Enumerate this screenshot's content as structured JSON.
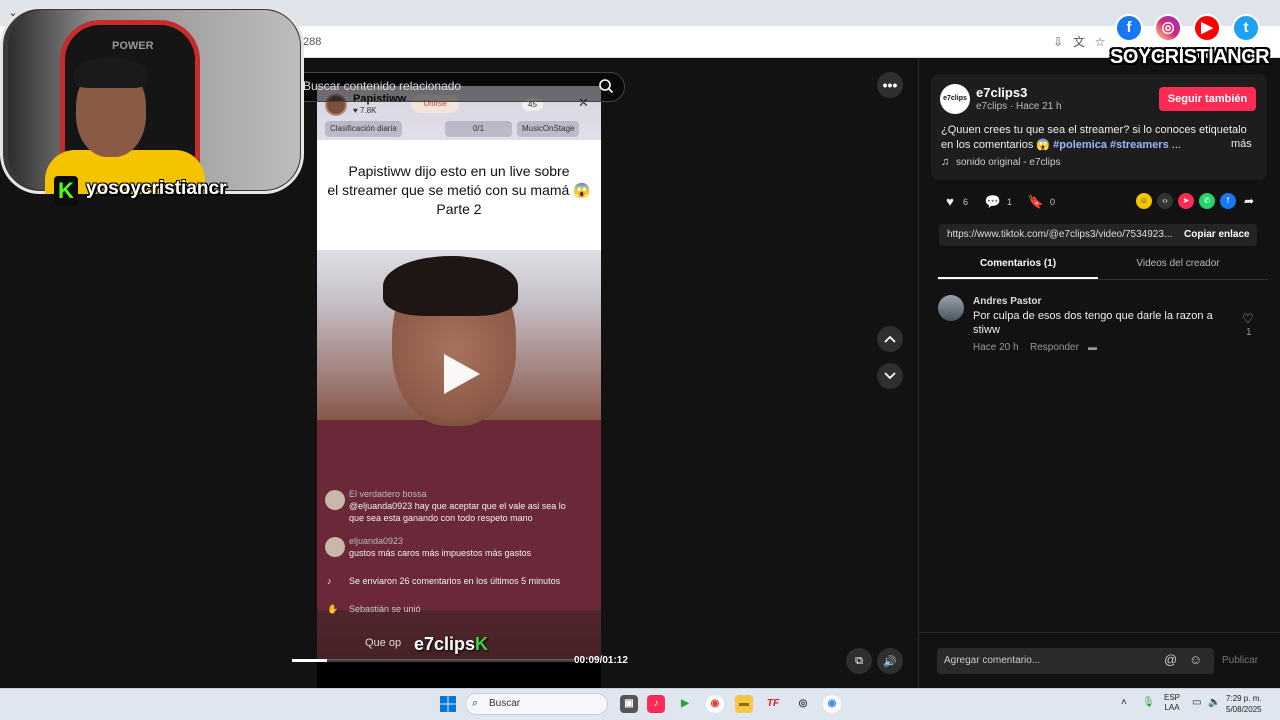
{
  "browser": {
    "address_fragment": "288",
    "dropdown_icon": "chevron-down-icon"
  },
  "search": {
    "placeholder": "Buscar contenido relacionado"
  },
  "webcam": {
    "chair_brand": "POWER",
    "handle": "yosoycristiancr",
    "kick_letter": "K"
  },
  "social_overlay": {
    "handle": "SOYCRISTIANCR",
    "icons": [
      "facebook-icon",
      "instagram-icon",
      "youtube-icon",
      "twitter-icon"
    ],
    "letters": [
      "f",
      "◎",
      "▶",
      "t"
    ]
  },
  "video": {
    "live_host": "Papistiww",
    "live_likes": "♥ 7.8K",
    "join_label": "Unirse",
    "viewer_count": "45",
    "pill_ranking": "Clasificación diaria",
    "pill_count": "0/1",
    "pill_music": "MusicOnStage",
    "caption_line1": "Papistiww dijo esto en un live sobre",
    "caption_line2": "el streamer que se metió con su mamá 😱",
    "caption_line3": "Parte 2",
    "chat": [
      {
        "name": "El verdadero bossa",
        "text": "@eljuanda0923 hay que aceptar que el vale asi sea lo"
      },
      {
        "name": "",
        "text": "que sea esta ganando con todo respeto mano"
      },
      {
        "name": "eljuanda0923",
        "text": "gustos más caros más impuestos más gastos"
      },
      {
        "name": "",
        "text": "Se enviaron 26 comentarios en los últimos 5 minutos"
      },
      {
        "name": "",
        "text": "Sebastián se unió"
      }
    ],
    "input_hint": "Que op",
    "watermark_text": "e7clips",
    "watermark_k": "K",
    "time": "00:09/01:12",
    "progress": 0.125
  },
  "creator": {
    "avatar_text": "e7clips K",
    "name": "e7clips3",
    "sub": "e7clips · Hace 21 h",
    "follow_label": "Seguir también",
    "desc_text": "¿Quuen crees tu que sea el streamer? si lo conoces etiquetalo en los comentarios 😱 ",
    "desc_tags": "#polemica #streamers",
    "desc_ellipsis": " ...",
    "more_label": "más",
    "sound": "sonido original - e7clips"
  },
  "stats": {
    "likes": "6",
    "comments": "1",
    "saves": "0"
  },
  "share": {
    "link": "https://www.tiktok.com/@e7clips3/video/7534923...",
    "copy_label": "Copiar enlace"
  },
  "tabs": {
    "comments": "Comentarios (1)",
    "videos": "Videos del creador"
  },
  "comment": {
    "user": "Andres Pastor",
    "text": "Por culpa de esos dos tengo que darle la razon a stiww",
    "time": "Hace 20 h",
    "reply": "Responder",
    "likes": "1"
  },
  "comment_box": {
    "placeholder": "Agregar comentario...",
    "publish": "Publicar"
  },
  "taskbar": {
    "search": "Buscar",
    "lang1": "ESP",
    "lang2": "LAA",
    "time": "7:29 p. m.",
    "date": "5/08/2025"
  },
  "colors": {
    "accent": "#fe2c55",
    "kick_green": "#53fc18",
    "hashtag": "#9fb8ff"
  }
}
